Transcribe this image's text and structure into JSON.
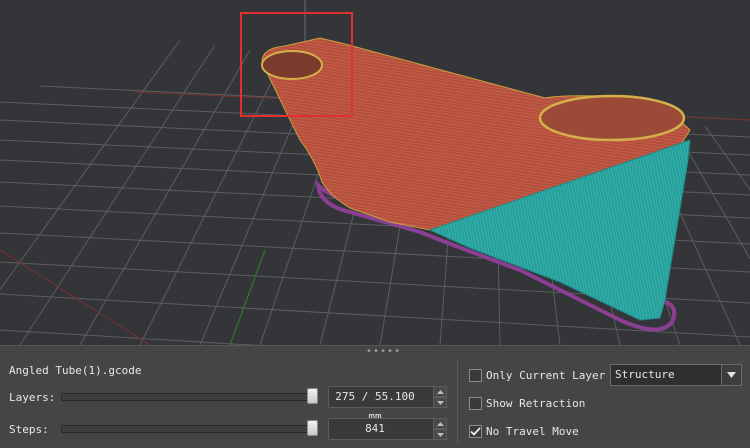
{
  "file": {
    "name": "Angled Tube(1).gcode"
  },
  "layers": {
    "label": "Layers:",
    "value": "275 / 55.100 mm",
    "fraction": 1.0
  },
  "steps": {
    "label": "Steps:",
    "value": "841",
    "fraction": 1.0
  },
  "options": {
    "only_current_layer": {
      "label": "Only Current Layer",
      "checked": false
    },
    "show_retraction": {
      "label": "Show Retraction",
      "checked": false
    },
    "no_travel_move": {
      "label": "No Travel Move",
      "checked": true
    }
  },
  "view_mode": {
    "selected": "Structure"
  },
  "colors": {
    "viewport_bg": "#333538",
    "grid_line": "#5c5e61",
    "wall_red": "#b8533e",
    "infill_cyan": "#2aa7a3",
    "skirt_purple": "#8a3f93",
    "highlight_box": "#e03030"
  },
  "icons": {
    "grip": "grip-dots-icon",
    "spin_up": "chevron-up-icon",
    "spin_down": "chevron-down-icon",
    "checkmark": "checkmark-icon",
    "dropdown": "triangle-down-icon"
  }
}
